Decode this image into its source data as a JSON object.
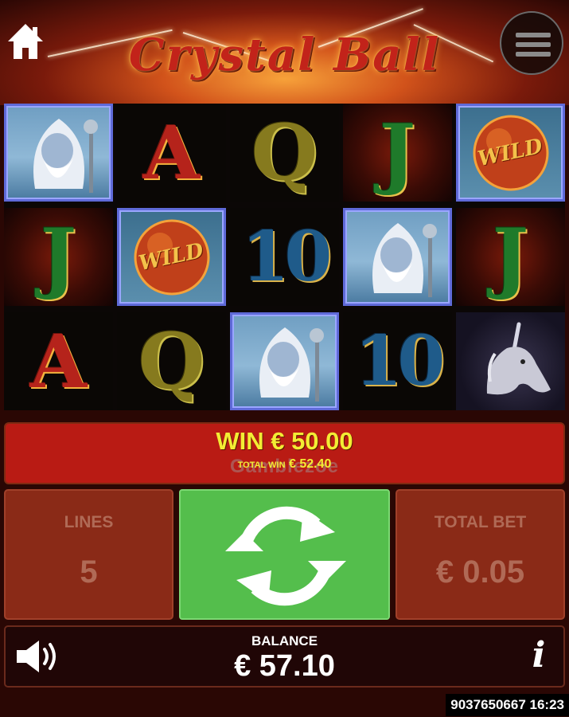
{
  "game": {
    "title": "Crystal Ball"
  },
  "icons": {
    "home": "home-icon",
    "menu": "hamburger-menu-icon",
    "sound": "speaker-icon",
    "info": "info-icon",
    "spin": "spin-arrows-icon"
  },
  "reels": [
    [
      "wizard",
      "J",
      "A"
    ],
    [
      "A",
      "wild",
      "Q"
    ],
    [
      "Q",
      "10",
      "wizard"
    ],
    [
      "J",
      "wizard",
      "10"
    ],
    [
      "wild",
      "J",
      "unicorn"
    ]
  ],
  "symbol_labels": {
    "wild": "WILD"
  },
  "win": {
    "label": "WIN € 50.00",
    "total_label": "TOTAL WIN",
    "total_value": "€ 52.40",
    "watermark": "Gamblezoe"
  },
  "controls": {
    "lines_label": "LINES",
    "lines_value": "5",
    "total_bet_label": "TOTAL BET",
    "total_bet_value": "€ 0.05"
  },
  "balance": {
    "label": "BALANCE",
    "value": "€ 57.10"
  },
  "footer": {
    "session": "9037650667 16:23"
  },
  "colors": {
    "accent_win": "#f3ec34",
    "spin_green": "#54be4c",
    "panel_red": "#8a2a17",
    "win_bar": "#b91b14",
    "highlight_frame": "#5f6ad8"
  }
}
